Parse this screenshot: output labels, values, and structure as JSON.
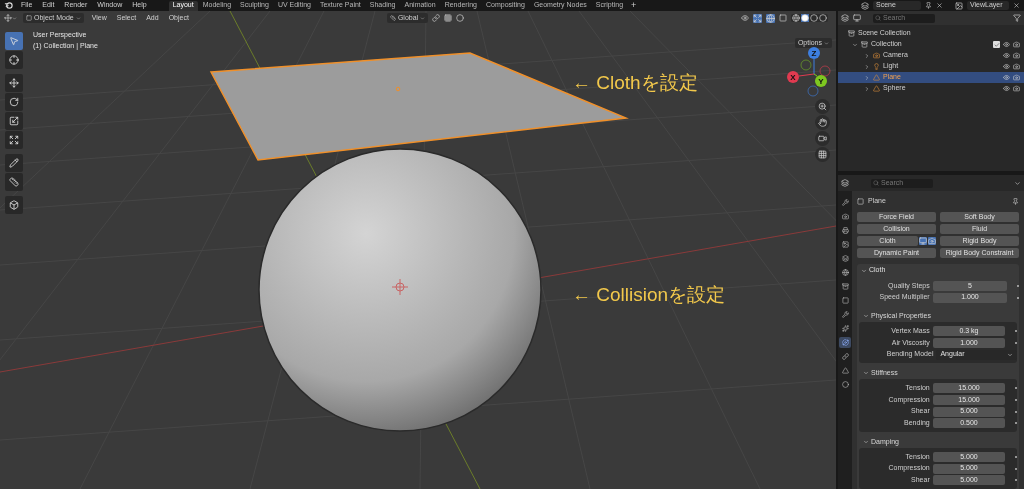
{
  "menu": [
    "File",
    "Edit",
    "Render",
    "Window",
    "Help"
  ],
  "workspaces": [
    {
      "label": "Layout",
      "selected": true
    },
    {
      "label": "Modeling",
      "selected": false
    },
    {
      "label": "Sculpting",
      "selected": false
    },
    {
      "label": "UV Editing",
      "selected": false
    },
    {
      "label": "Texture Paint",
      "selected": false
    },
    {
      "label": "Shading",
      "selected": false
    },
    {
      "label": "Animation",
      "selected": false
    },
    {
      "label": "Rendering",
      "selected": false
    },
    {
      "label": "Compositing",
      "selected": false
    },
    {
      "label": "Geometry Nodes",
      "selected": false
    },
    {
      "label": "Scripting",
      "selected": false
    }
  ],
  "add_workspace": "+",
  "scene": "Scene",
  "view_layer": "ViewLayer",
  "viewport": {
    "mode": "Object Mode",
    "menus": [
      "View",
      "Select",
      "Add",
      "Object"
    ],
    "orientation": "Global",
    "options": "Options",
    "overlay_lines": [
      "User Perspective",
      "(1) Collection | Plane"
    ],
    "tools": [
      {
        "kind": "select",
        "selected": true
      },
      {
        "kind": "cursor",
        "selected": false
      },
      {
        "kind": "move",
        "selected": false
      },
      {
        "kind": "rotate",
        "selected": false
      },
      {
        "kind": "scale",
        "selected": false
      },
      {
        "kind": "transform",
        "selected": false
      },
      {
        "kind": "annotate",
        "selected": false
      },
      {
        "kind": "measure",
        "selected": false
      },
      {
        "kind": "add-cube",
        "selected": false
      }
    ],
    "gizmo": {
      "z": "Z",
      "x": "X",
      "y": "Y"
    },
    "annotations": [
      "← Clothを設定",
      "← Collisionを設定"
    ]
  },
  "outliner": {
    "search_placeholder": "Search",
    "root": "Scene Collection",
    "collection": {
      "label": "Collection",
      "expanded": true,
      "checked": true,
      "children": [
        {
          "label": "Camera",
          "kind": "camera",
          "selected": false
        },
        {
          "label": "Light",
          "kind": "light",
          "selected": false
        },
        {
          "label": "Plane",
          "kind": "mesh",
          "selected": true
        },
        {
          "label": "Sphere",
          "kind": "mesh",
          "selected": false
        }
      ]
    }
  },
  "properties": {
    "search_placeholder": "Search",
    "object": "Plane",
    "tabs": [
      {
        "kind": "tool",
        "selected": false
      },
      {
        "kind": "render",
        "selected": false
      },
      {
        "kind": "output",
        "selected": false
      },
      {
        "kind": "view-layer",
        "selected": false
      },
      {
        "kind": "scene",
        "selected": false
      },
      {
        "kind": "world",
        "selected": false
      },
      {
        "kind": "collection",
        "selected": false
      },
      {
        "kind": "object",
        "selected": false
      },
      {
        "kind": "modifiers",
        "selected": false
      },
      {
        "kind": "particles",
        "selected": false
      },
      {
        "kind": "physics",
        "selected": true
      },
      {
        "kind": "constraints",
        "selected": false
      },
      {
        "kind": "data",
        "selected": false
      },
      {
        "kind": "material",
        "selected": false
      }
    ],
    "physics_buttons": [
      {
        "label": "Force Field",
        "enabled": false
      },
      {
        "label": "Soft Body",
        "enabled": false
      },
      {
        "label": "Collision",
        "enabled": false
      },
      {
        "label": "Fluid",
        "enabled": false
      },
      {
        "label": "Cloth",
        "enabled": true
      },
      {
        "label": "Rigid Body",
        "enabled": false
      },
      {
        "label": "Dynamic Paint",
        "enabled": false
      },
      {
        "label": "Rigid Body Constraint",
        "enabled": false
      }
    ],
    "panel": {
      "title": "Cloth",
      "expanded": true,
      "fields": [
        {
          "label": "Quality Steps",
          "value": "5",
          "kind": "number"
        },
        {
          "label": "Speed Multiplier",
          "value": "1.000",
          "kind": "number"
        }
      ],
      "subpanels": [
        {
          "title": "Physical Properties",
          "expanded": true,
          "fields": [
            {
              "label": "Vertex Mass",
              "value": "0.3 kg",
              "kind": "number"
            },
            {
              "label": "Air Viscosity",
              "value": "1.000",
              "kind": "number"
            },
            {
              "label": "Bending Model",
              "value": "Angular",
              "kind": "dropdown"
            }
          ]
        },
        {
          "title": "Stiffness",
          "expanded": true,
          "fields": [
            {
              "label": "Tension",
              "value": "15.000",
              "kind": "number"
            },
            {
              "label": "Compression",
              "value": "15.000",
              "kind": "number"
            },
            {
              "label": "Shear",
              "value": "5.000",
              "kind": "number"
            },
            {
              "label": "Bending",
              "value": "0.500",
              "kind": "number"
            }
          ]
        },
        {
          "title": "Damping",
          "expanded": true,
          "fields": [
            {
              "label": "Tension",
              "value": "5.000",
              "kind": "number"
            },
            {
              "label": "Compression",
              "value": "5.000",
              "kind": "number"
            },
            {
              "label": "Shear",
              "value": "5.000",
              "kind": "number"
            }
          ]
        }
      ]
    }
  }
}
